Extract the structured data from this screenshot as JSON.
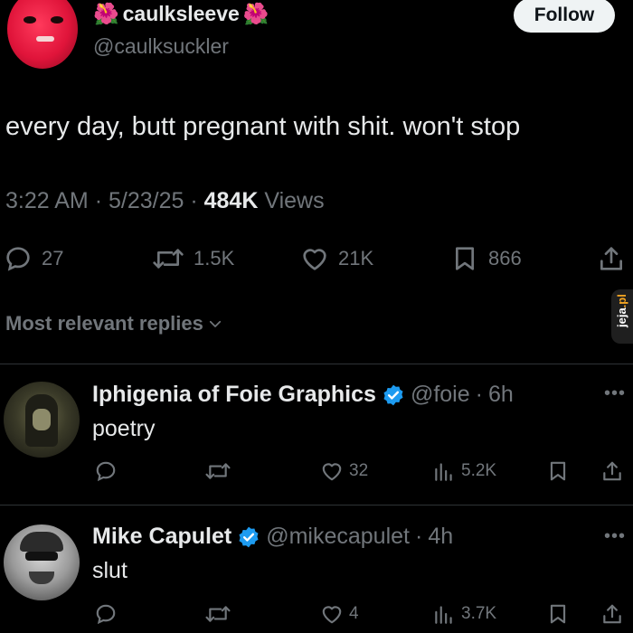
{
  "tweet": {
    "display_name": "caulksleeve",
    "name_emoji": "🌺",
    "handle": "@caulksuckler",
    "follow_label": "Follow",
    "text": "every day,  butt pregnant with shit. won't stop",
    "time": "3:22 AM",
    "date": "5/23/25",
    "views_count": "484K",
    "views_label": "Views",
    "actions": {
      "replies": "27",
      "reposts": "1.5K",
      "likes": "21K",
      "bookmarks": "866"
    }
  },
  "replies_sort_label": "Most relevant replies",
  "watermark": {
    "prefix": "jeja",
    "suffix": ".pl"
  },
  "replies": [
    {
      "name": "Iphigenia of Foie Graphics",
      "handle": "@foie",
      "time": "6h",
      "text": "poetry",
      "likes": "32",
      "views": "5.2K"
    },
    {
      "name": "Mike Capulet",
      "handle": "@mikecapulet",
      "time": "4h",
      "text": "slut",
      "likes": "4",
      "views": "3.7K"
    }
  ],
  "colors": {
    "background": "#000000",
    "text": "#e7e9ea",
    "muted": "#71767b",
    "verified": "#1d9bf0"
  }
}
